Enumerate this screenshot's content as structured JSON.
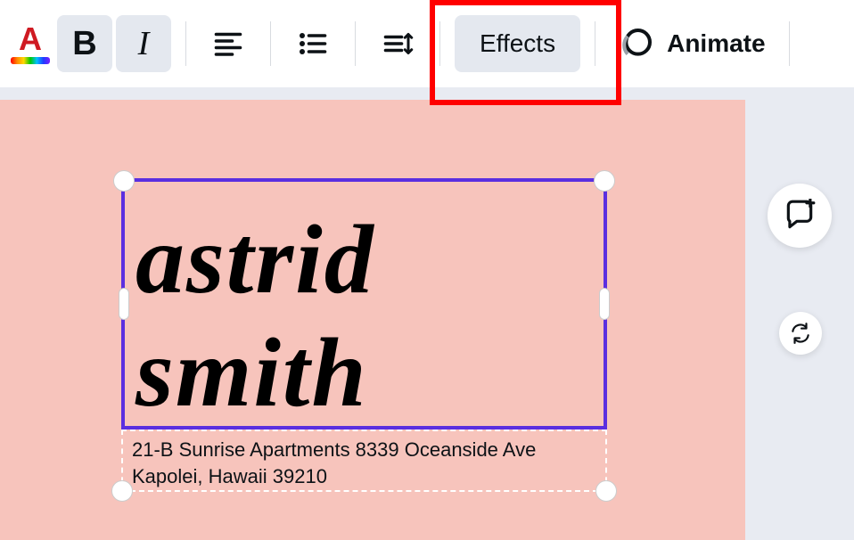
{
  "toolbar": {
    "font_color_letter": "A",
    "bold_label": "B",
    "italic_label": "I",
    "effects_label": "Effects",
    "animate_label": "Animate"
  },
  "canvas": {
    "name_text": "astrid smith",
    "address_text": "21-B Sunrise Apartments 8339 Oceanside Ave Kapolei, Hawaii 39210"
  },
  "colors": {
    "selection": "#5a2fe0",
    "canvas_bg": "#f7c4bc",
    "highlight": "#ff0000"
  }
}
